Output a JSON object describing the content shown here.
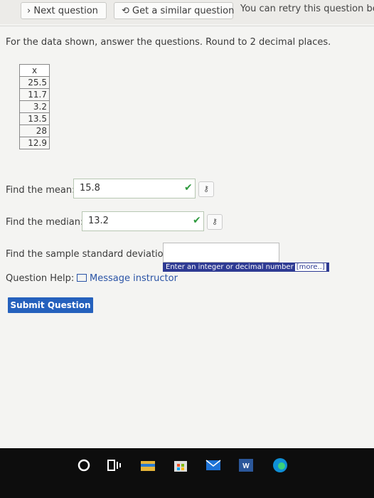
{
  "toolbar": {
    "next_label": "Next question",
    "similar_label": "Get a similar question",
    "retry_text": "You can retry this question be"
  },
  "instructions": "For the data shown, answer the questions. Round to 2 decimal places.",
  "table": {
    "header": "x",
    "values": [
      "25.5",
      "11.7",
      "3.2",
      "13.5",
      "28",
      "12.9"
    ]
  },
  "questions": {
    "mean_label": "Find the mean:",
    "mean_value": "15.8",
    "median_label": "Find the median:",
    "median_value": "13.2",
    "sd_label": "Find the sample standard deviation:",
    "sd_hint": "Enter an integer or decimal number",
    "sd_hint_more": "[more..]"
  },
  "help": {
    "label": "Question Help:",
    "message_link": "Message instructor"
  },
  "submit_label": "Submit Question",
  "colors": {
    "accent_blue": "#2561bd",
    "hint_bg": "#2e3a93",
    "correct_green": "#2e9a3e"
  },
  "taskbar_icons": [
    "cortana-circle-icon",
    "task-view-icon",
    "file-explorer-icon",
    "store-icon",
    "mail-icon",
    "word-icon",
    "edge-icon"
  ]
}
